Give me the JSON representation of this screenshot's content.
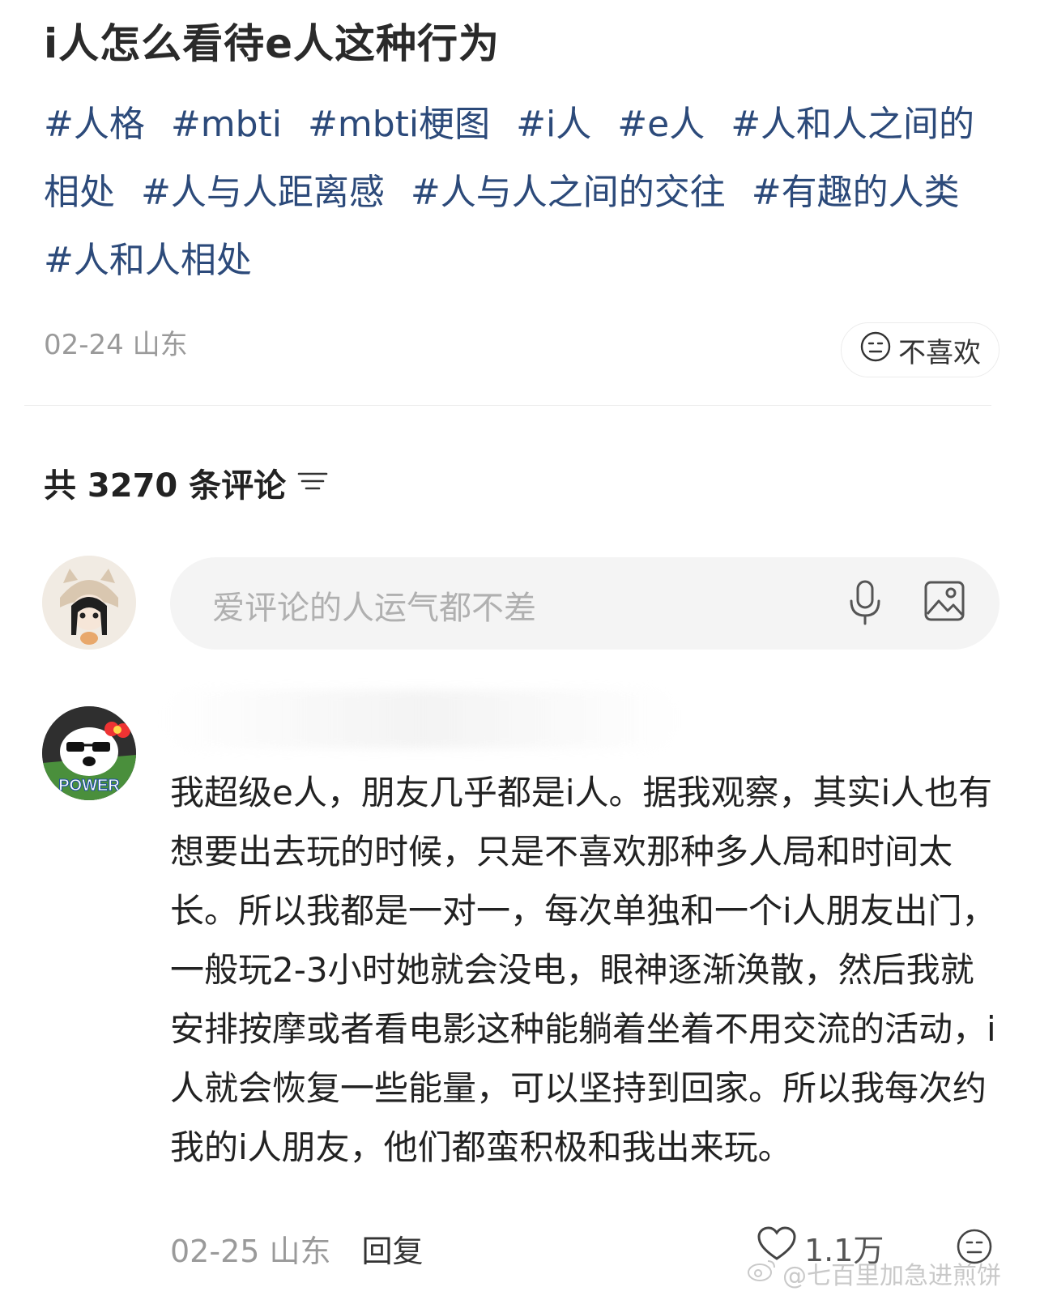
{
  "post": {
    "title": "i人怎么看待e人这种行为",
    "tags": [
      "#人格",
      "#mbti",
      "#mbti梗图",
      "#i人",
      "#e人",
      "#人和人之间的相处",
      "#人与人距离感",
      "#人与人之间的交往",
      "#有趣的人类",
      "#人和人相处"
    ],
    "date": "02-24",
    "location": "山东",
    "dislike_label": "不喜欢"
  },
  "comments_header": {
    "count_label": "共 3270 条评论"
  },
  "input": {
    "placeholder": "爱评论的人运气都不差"
  },
  "comment": {
    "avatar_text": "POWER",
    "text": "我超级e人，朋友几乎都是i人。据我观察，其实i人也有想要出去玩的时候，只是不喜欢那种多人局和时间太长。所以我都是一对一，每次单独和一个i人朋友出门，一般玩2-3小时她就会没电，眼神逐渐涣散，然后我就安排按摩或者看电影这种能躺着坐着不用交流的活动，i人就会恢复一些能量，可以坚持到回家。所以我每次约我的i人朋友，他们都蛮积极和我出来玩。",
    "date": "02-25",
    "location": "山东",
    "reply_label": "回复",
    "likes": "1.1万"
  },
  "watermark": {
    "text": "@七百里加急进煎饼"
  },
  "colors": {
    "tag": "#2c4a7a",
    "muted": "#9a9a9a",
    "input_bg": "#f4f4f4"
  }
}
